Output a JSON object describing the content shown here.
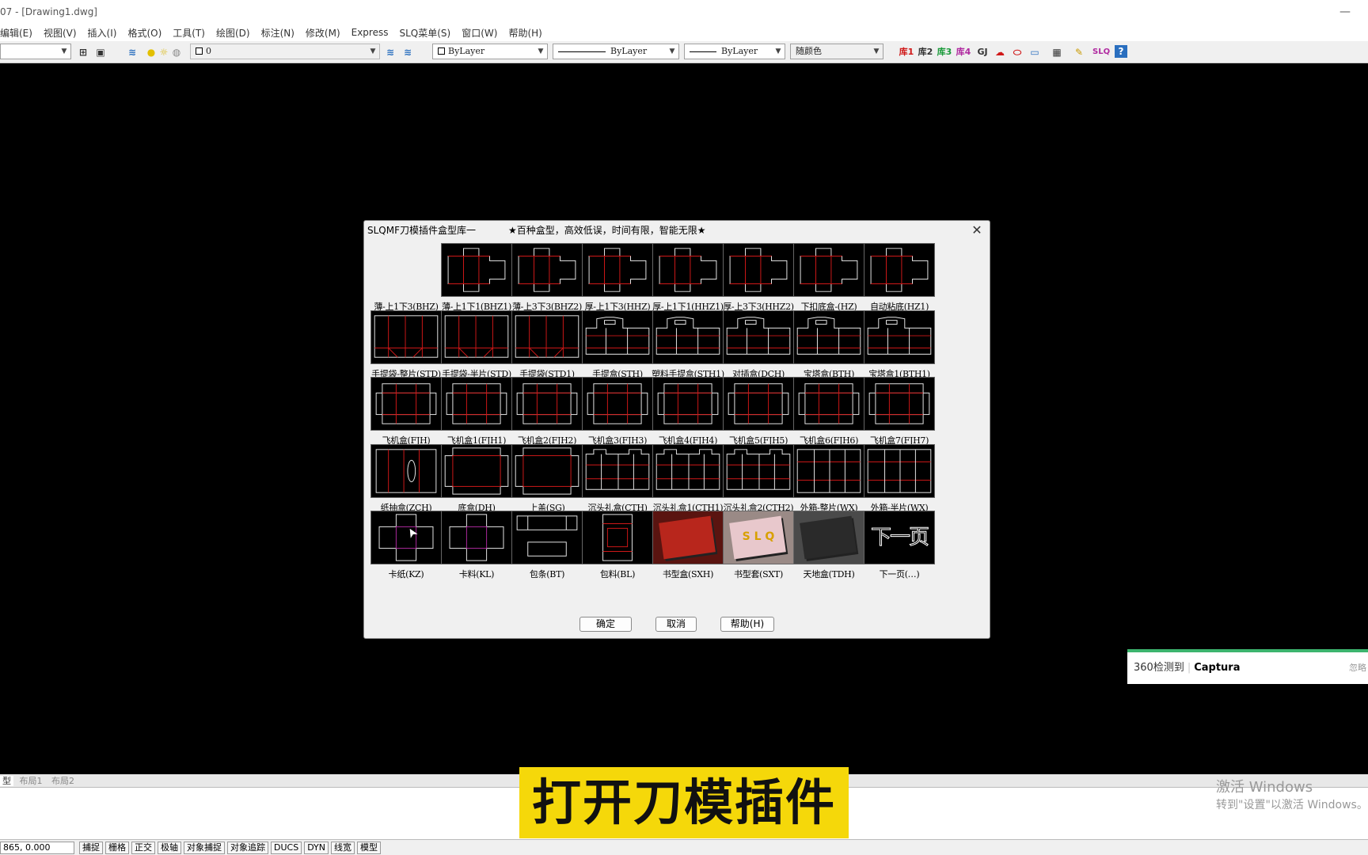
{
  "window": {
    "title": "07 - [Drawing1.dwg]",
    "minimize": "—"
  },
  "menu": [
    "编辑(E)",
    "视图(V)",
    "插入(I)",
    "格式(O)",
    "工具(T)",
    "绘图(D)",
    "标注(N)",
    "修改(M)",
    "Express",
    "SLQ菜单(S)",
    "窗口(W)",
    "帮助(H)"
  ],
  "toolbar": {
    "layer_value": "0",
    "color_value": "ByLayer",
    "linetype_value": "ByLayer",
    "lineweight_value": "ByLayer",
    "plotstyle_value": "随颜色",
    "plugin_icons": [
      "库1",
      "库2",
      "库3",
      "库4",
      "GJ",
      "SLQ",
      "?"
    ]
  },
  "dialog": {
    "title": "SLQMF刀模插件盒型库一",
    "slogan": "★百种盒型，高效低误，时间有限，智能无限★",
    "close": "✕",
    "items": [
      {
        "label": "薄-上1下3(BHZ)",
        "thumb": "empty"
      },
      {
        "label": "薄-上1下1(BHZ1)",
        "thumb": "box"
      },
      {
        "label": "薄-上3下3(BHZ2)",
        "thumb": "box"
      },
      {
        "label": "厚-上1下3(HHZ)",
        "thumb": "box"
      },
      {
        "label": "厚-上1下1(HHZ1)",
        "thumb": "box"
      },
      {
        "label": "厚-上3下3(HHZ2)",
        "thumb": "box"
      },
      {
        "label": "下扣底盒-(HZ)",
        "thumb": "box"
      },
      {
        "label": "自动粘底(HZ1)",
        "thumb": "box"
      },
      {
        "label": "手提袋-整片(STD)",
        "thumb": "bag"
      },
      {
        "label": "手提袋-半片(STD)",
        "thumb": "bag"
      },
      {
        "label": "手提袋(STD1)",
        "thumb": "bag"
      },
      {
        "label": "手提盒(STH)",
        "thumb": "handle"
      },
      {
        "label": "塑料手提盒(STH1)",
        "thumb": "handle"
      },
      {
        "label": "对插盒(DCH)",
        "thumb": "handle"
      },
      {
        "label": "宝塔盒(BTH)",
        "thumb": "handle"
      },
      {
        "label": "宝塔盒1(BTH1)",
        "thumb": "handle"
      },
      {
        "label": "飞机盒(FJH)",
        "thumb": "plane"
      },
      {
        "label": "飞机盒1(FJH1)",
        "thumb": "plane"
      },
      {
        "label": "飞机盒2(FJH2)",
        "thumb": "plane"
      },
      {
        "label": "飞机盒3(FJH3)",
        "thumb": "plane"
      },
      {
        "label": "飞机盒4(FJH4)",
        "thumb": "plane"
      },
      {
        "label": "飞机盒5(FJH5)",
        "thumb": "plane"
      },
      {
        "label": "飞机盒6(FJH6)",
        "thumb": "plane"
      },
      {
        "label": "飞机盒7(FJH7)",
        "thumb": "plane"
      },
      {
        "label": "纸抽盒(ZCH)",
        "thumb": "tissue"
      },
      {
        "label": "底盒(DH)",
        "thumb": "tray"
      },
      {
        "label": "上盖(SG)",
        "thumb": "tray"
      },
      {
        "label": "沉头礼盒(CTH)",
        "thumb": "gift"
      },
      {
        "label": "沉头礼盒1(CTH1)",
        "thumb": "gift"
      },
      {
        "label": "沉头礼盒2(CTH2)",
        "thumb": "gift"
      },
      {
        "label": "外箱-整片(WX)",
        "thumb": "carton"
      },
      {
        "label": "外箱-半片(WX)",
        "thumb": "carton"
      },
      {
        "label": "卡纸(KZ)",
        "thumb": "cross"
      },
      {
        "label": "卡料(KL)",
        "thumb": "cross"
      },
      {
        "label": "包条(BT)",
        "thumb": "strip"
      },
      {
        "label": "包料(BL)",
        "thumb": "wrap"
      },
      {
        "label": "书型盒(SXH)",
        "thumb": "photo-red"
      },
      {
        "label": "书型套(SXT)",
        "thumb": "photo-pink"
      },
      {
        "label": "天地盒(TDH)",
        "thumb": "photo-gray"
      },
      {
        "label": "下一页(…)",
        "thumb": "next"
      }
    ],
    "next_page_art": "下一页",
    "photo_text": "S L Q",
    "buttons": {
      "ok": "确定",
      "cancel": "取消",
      "help": "帮助(H)"
    }
  },
  "tabs": [
    "型",
    "布局1",
    "布局2"
  ],
  "status": {
    "coords": "865, 0.000",
    "toggles": [
      "捕捉",
      "栅格",
      "正交",
      "极轴",
      "对象捕捉",
      "对象追踪",
      "DUCS",
      "DYN",
      "线宽",
      "模型"
    ]
  },
  "toast": {
    "prefix": "360检测到",
    "app": "Captura",
    "action": "忽略"
  },
  "caption": "打开刀模插件",
  "watermark": {
    "line1": "激活 Windows",
    "line2": "转到\"设置\"以激活 Windows。"
  },
  "colors": {
    "dieline_red": "#d01818",
    "dieline_white": "#e8e8e8",
    "caption_bg": "#f5d80a",
    "toast_accent": "#3cb46e"
  }
}
